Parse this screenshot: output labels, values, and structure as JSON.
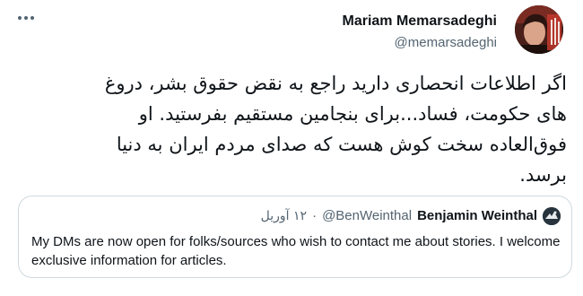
{
  "tweet": {
    "author_name": "Mariam Memarsadeghi",
    "author_handle": "@memarsadeghi",
    "text": "اگر اطلاعات انحصاری دارید راجع به نقض حقوق بشر، دروغ\nهای حکومت، فساد...برای بنجامین مستقیم بفرستید. او\nفوق‌العاده سخت کوش هست که صدای مردم ایران به دنیا\nبرسد.",
    "menu_icon": "more-options-icon"
  },
  "quoted_tweet": {
    "author_name": "Benjamin Weinthal",
    "author_handle": "@BenWeinthal",
    "separator": "·",
    "date": "۱۲ آوریل",
    "text": "My DMs are now open for folks/sources who wish to contact me about stories. I welcome exclusive information for articles."
  },
  "colors": {
    "text_primary": "#0f1419",
    "text_secondary": "#536471",
    "border": "#cfd9de"
  }
}
